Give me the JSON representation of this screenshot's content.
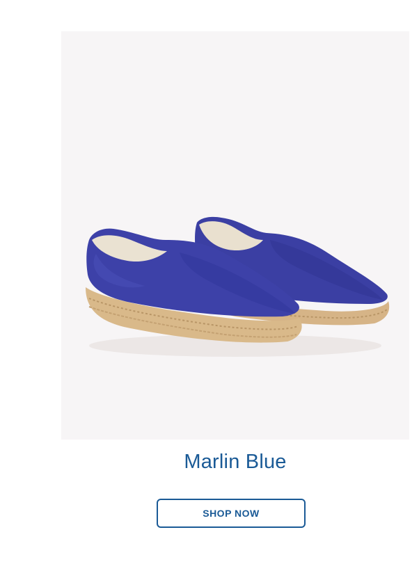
{
  "product": {
    "image_alt": "Marlin Blue espadrilles",
    "name": "Marlin Blue",
    "cta_label": "SHOP NOW"
  },
  "colors": {
    "accent": "#1a5a96",
    "canvas_blue": "#3b3fa3",
    "jute": "#d9b98a",
    "image_background": "#f7f5f6"
  }
}
